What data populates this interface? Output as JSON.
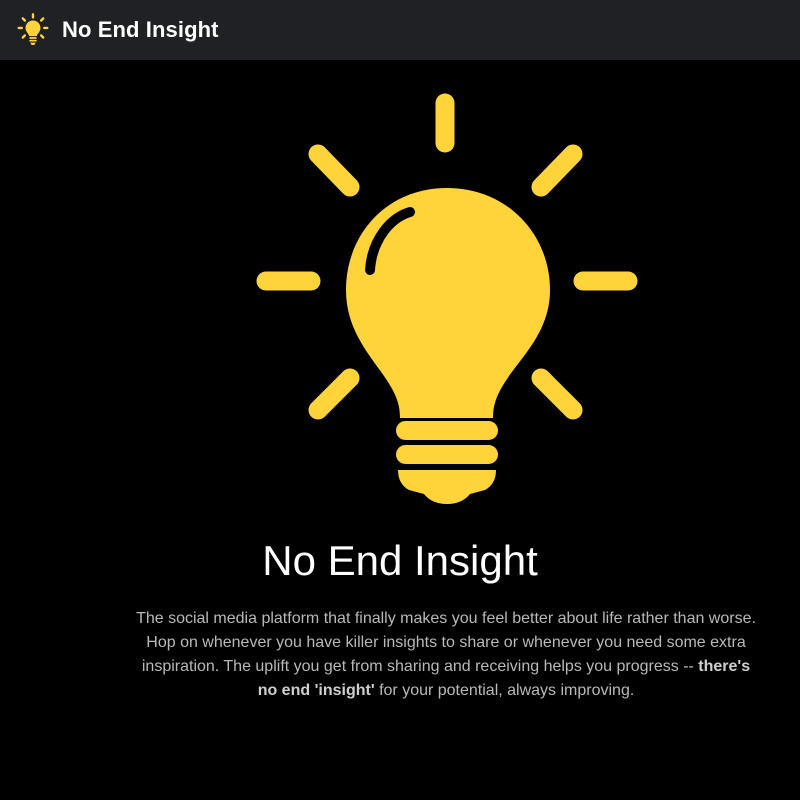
{
  "app": {
    "title": "No End Insight",
    "accent_color": "#FFD43B",
    "navbar_color": "#1F2124",
    "background_color": "#000000"
  },
  "navbar": {
    "logo_icon": "lightbulb-icon",
    "brand": "No End Insight"
  },
  "hero": {
    "illustration_icon": "lightbulb-icon",
    "title": "No End Insight",
    "description_part1": "The social media platform that finally makes you feel better about life rather than worse. Hop on whenever you have killer insights to share or whenever you need some extra inspiration. The uplift you get from sharing and receiving helps you progress -- ",
    "description_bold": "there's no end 'insight'",
    "description_part2": " for your potential, always improving."
  }
}
